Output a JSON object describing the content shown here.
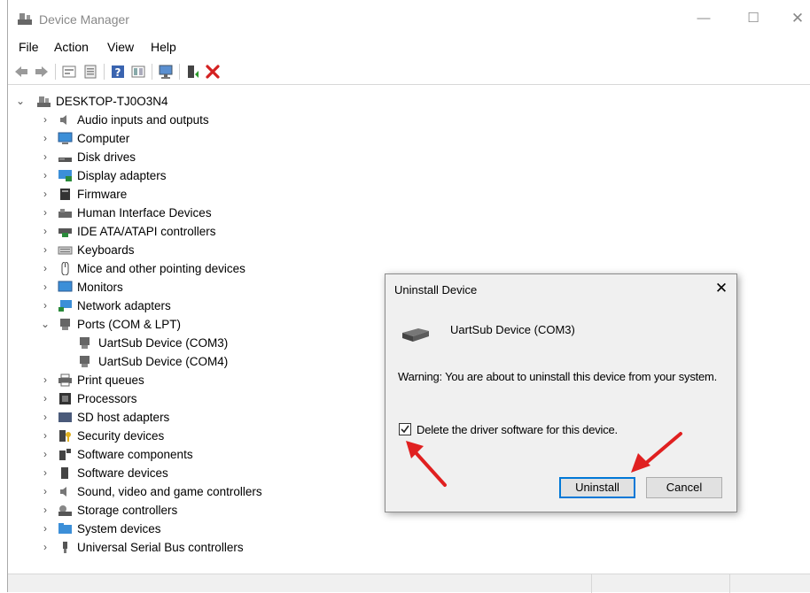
{
  "window": {
    "title": "Device Manager",
    "controls": {
      "minimize": "—",
      "maximize": "☐",
      "close": "✕"
    }
  },
  "menu": [
    "File",
    "Action",
    "View",
    "Help"
  ],
  "toolbar": [
    "back-icon",
    "forward-icon",
    "properties-icon",
    "show-hide-icon",
    "help-icon",
    "view-icon",
    "scan-hardware-icon",
    "update-driver-icon",
    "uninstall-device-icon"
  ],
  "tree": {
    "root": "DESKTOP-TJ0O3N4",
    "items": [
      {
        "label": "Audio inputs and outputs",
        "icon": "speaker-icon"
      },
      {
        "label": "Computer",
        "icon": "computer-icon"
      },
      {
        "label": "Disk drives",
        "icon": "disk-drive-icon"
      },
      {
        "label": "Display adapters",
        "icon": "display-adapter-icon"
      },
      {
        "label": "Firmware",
        "icon": "firmware-icon"
      },
      {
        "label": "Human Interface Devices",
        "icon": "hid-icon"
      },
      {
        "label": "IDE ATA/ATAPI controllers",
        "icon": "ide-controller-icon"
      },
      {
        "label": "Keyboards",
        "icon": "keyboard-icon"
      },
      {
        "label": "Mice and other pointing devices",
        "icon": "mouse-icon"
      },
      {
        "label": "Monitors",
        "icon": "monitor-icon"
      },
      {
        "label": "Network adapters",
        "icon": "network-adapter-icon"
      },
      {
        "label": "Ports (COM & LPT)",
        "icon": "port-icon",
        "expanded": true,
        "children": [
          {
            "label": "UartSub Device (COM3)",
            "icon": "port-icon"
          },
          {
            "label": "UartSub Device (COM4)",
            "icon": "port-icon"
          }
        ]
      },
      {
        "label": "Print queues",
        "icon": "printer-icon"
      },
      {
        "label": "Processors",
        "icon": "processor-icon"
      },
      {
        "label": "SD host adapters",
        "icon": "sd-adapter-icon"
      },
      {
        "label": "Security devices",
        "icon": "security-icon"
      },
      {
        "label": "Software components",
        "icon": "software-component-icon"
      },
      {
        "label": "Software devices",
        "icon": "software-device-icon"
      },
      {
        "label": "Sound, video and game controllers",
        "icon": "sound-icon"
      },
      {
        "label": "Storage controllers",
        "icon": "storage-icon"
      },
      {
        "label": "System devices",
        "icon": "system-devices-icon"
      },
      {
        "label": "Universal Serial Bus controllers",
        "icon": "usb-icon"
      }
    ]
  },
  "dialog": {
    "title": "Uninstall Device",
    "close": "✕",
    "device_name": "UartSub Device (COM3)",
    "warning": "Warning: You are about to uninstall this device from your system.",
    "checkbox_label": "Delete the driver software for this device.",
    "checkbox_checked": true,
    "buttons": {
      "primary": "Uninstall",
      "secondary": "Cancel"
    }
  },
  "colors": {
    "accent": "#0078d7",
    "arrow": "#e02020",
    "uninstall_x": "#d42020"
  }
}
